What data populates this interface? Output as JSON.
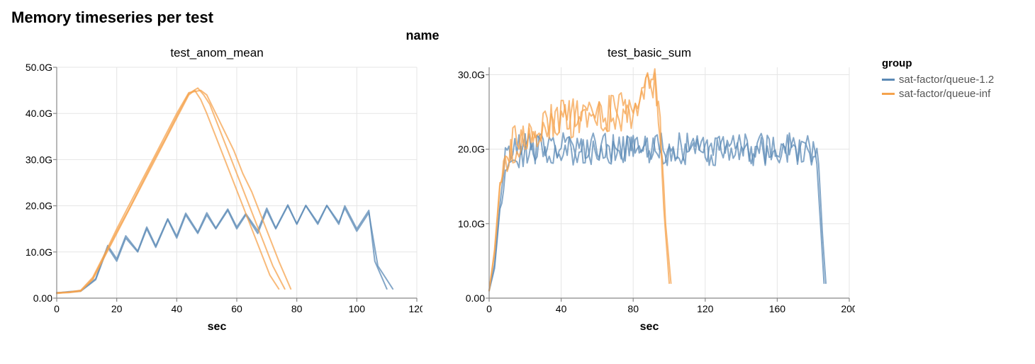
{
  "title": "Memory timeseries per test",
  "facet_label": "name",
  "xlabel": "sec",
  "legend": {
    "title": "group",
    "entries": [
      {
        "name": "sat-factor/queue-1.2",
        "color": "#5b89b5"
      },
      {
        "name": "sat-factor/queue-inf",
        "color": "#f5a34d"
      }
    ]
  },
  "chart_data": [
    {
      "panel_title": "test_anom_mean",
      "type": "line",
      "xlabel": "sec",
      "ylabel": "",
      "xlim": [
        0,
        120
      ],
      "ylim": [
        0,
        50
      ],
      "xticks": [
        0,
        20,
        40,
        60,
        80,
        100,
        120
      ],
      "yticks": [
        0,
        10,
        20,
        30,
        40,
        50
      ],
      "ytick_labels": [
        "0.00",
        "10.0G",
        "20.0G",
        "30.0G",
        "40.0G",
        "50.0G"
      ],
      "series": [
        {
          "name": "sat-factor/queue-1.2",
          "color": "#5b89b5",
          "runs": [
            [
              [
                0,
                1.2
              ],
              [
                4,
                1.3
              ],
              [
                8,
                1.5
              ],
              [
                13,
                4
              ],
              [
                17,
                11
              ],
              [
                20,
                8
              ],
              [
                23,
                13
              ],
              [
                27,
                10
              ],
              [
                30,
                15
              ],
              [
                33,
                11
              ],
              [
                37,
                17
              ],
              [
                40,
                13
              ],
              [
                43,
                18
              ],
              [
                47,
                14
              ],
              [
                50,
                18
              ],
              [
                53,
                15
              ],
              [
                57,
                19
              ],
              [
                60,
                15
              ],
              [
                63,
                18
              ],
              [
                67,
                14
              ],
              [
                70,
                19
              ],
              [
                73,
                15
              ],
              [
                77,
                20
              ],
              [
                80,
                16
              ],
              [
                83,
                20
              ],
              [
                87,
                16
              ],
              [
                90,
                20
              ],
              [
                94,
                16
              ],
              [
                96,
                20
              ],
              [
                100,
                15
              ],
              [
                104,
                19
              ],
              [
                106,
                8
              ],
              [
                110,
                2
              ]
            ],
            [
              [
                0,
                1.1
              ],
              [
                4,
                1.4
              ],
              [
                8,
                1.6
              ],
              [
                13,
                4.2
              ],
              [
                17,
                11.4
              ],
              [
                20,
                8.5
              ],
              [
                23,
                13.5
              ],
              [
                27,
                10.2
              ],
              [
                30,
                15.4
              ],
              [
                33,
                11.3
              ],
              [
                37,
                17.2
              ],
              [
                40,
                13.4
              ],
              [
                43,
                18.4
              ],
              [
                47,
                14.3
              ],
              [
                50,
                18.5
              ],
              [
                53,
                15.2
              ],
              [
                57,
                19.3
              ],
              [
                60,
                15.4
              ],
              [
                63,
                18.3
              ],
              [
                67,
                14.6
              ],
              [
                70,
                19.5
              ],
              [
                73,
                15.2
              ],
              [
                77,
                20.2
              ],
              [
                80,
                16.1
              ],
              [
                83,
                20.1
              ],
              [
                87,
                16.3
              ],
              [
                90,
                20.1
              ],
              [
                94,
                16.4
              ],
              [
                96,
                19.5
              ],
              [
                100,
                14.5
              ],
              [
                104,
                18.5
              ],
              [
                107,
                7
              ],
              [
                112,
                2
              ]
            ]
          ]
        },
        {
          "name": "sat-factor/queue-inf",
          "color": "#f5a34d",
          "runs": [
            [
              [
                0,
                1.2
              ],
              [
                4,
                1.3
              ],
              [
                8,
                1.6
              ],
              [
                12,
                4
              ],
              [
                16,
                9
              ],
              [
                20,
                14
              ],
              [
                24,
                19
              ],
              [
                28,
                24
              ],
              [
                32,
                29
              ],
              [
                36,
                34
              ],
              [
                40,
                39
              ],
              [
                44,
                44
              ],
              [
                46,
                45
              ],
              [
                48,
                43
              ],
              [
                50,
                40
              ],
              [
                53,
                35
              ],
              [
                56,
                30
              ],
              [
                59,
                25
              ],
              [
                62,
                20
              ],
              [
                65,
                15
              ],
              [
                68,
                10
              ],
              [
                71,
                5
              ],
              [
                74,
                2
              ]
            ],
            [
              [
                0,
                1.1
              ],
              [
                4,
                1.2
              ],
              [
                8,
                1.5
              ],
              [
                12,
                4.2
              ],
              [
                16,
                9.3
              ],
              [
                20,
                14.4
              ],
              [
                24,
                19.2
              ],
              [
                28,
                24.3
              ],
              [
                32,
                29.5
              ],
              [
                36,
                34.3
              ],
              [
                40,
                39.4
              ],
              [
                44,
                44.3
              ],
              [
                47,
                45.5
              ],
              [
                49,
                44
              ],
              [
                51,
                42
              ],
              [
                54,
                37
              ],
              [
                57,
                32
              ],
              [
                60,
                27
              ],
              [
                63,
                22
              ],
              [
                66,
                17
              ],
              [
                69,
                12
              ],
              [
                72,
                7
              ],
              [
                76,
                2
              ]
            ],
            [
              [
                0,
                1.0
              ],
              [
                4,
                1.3
              ],
              [
                8,
                1.7
              ],
              [
                12,
                4.5
              ],
              [
                16,
                9.6
              ],
              [
                20,
                15
              ],
              [
                24,
                20
              ],
              [
                28,
                25
              ],
              [
                32,
                30
              ],
              [
                36,
                35
              ],
              [
                40,
                40
              ],
              [
                44,
                44.5
              ],
              [
                48,
                45
              ],
              [
                50,
                44
              ],
              [
                53,
                40
              ],
              [
                56,
                36
              ],
              [
                59,
                32
              ],
              [
                62,
                27
              ],
              [
                65,
                23
              ],
              [
                68,
                18
              ],
              [
                71,
                13
              ],
              [
                74,
                8
              ],
              [
                78,
                2
              ]
            ]
          ]
        }
      ]
    },
    {
      "panel_title": "test_basic_sum",
      "type": "line",
      "xlabel": "sec",
      "ylabel": "",
      "xlim": [
        0,
        200
      ],
      "ylim": [
        0,
        31
      ],
      "xticks": [
        0,
        40,
        80,
        120,
        160,
        200
      ],
      "yticks": [
        0,
        10,
        20,
        30
      ],
      "ytick_labels": [
        "0.00",
        "10.0G",
        "20.0G",
        "30.0G"
      ],
      "series": [
        {
          "name": "sat-factor/queue-1.2",
          "color": "#5b89b5",
          "noise_amp": 2.2,
          "runs": [
            [
              [
                0,
                1
              ],
              [
                3,
                4
              ],
              [
                6,
                12
              ],
              [
                9,
                18
              ],
              [
                12,
                19
              ],
              [
                20,
                20
              ],
              [
                40,
                20
              ],
              [
                60,
                20
              ],
              [
                80,
                20
              ],
              [
                100,
                20
              ],
              [
                120,
                20
              ],
              [
                140,
                20
              ],
              [
                160,
                20
              ],
              [
                178,
                20
              ],
              [
                182,
                18
              ],
              [
                184,
                10
              ],
              [
                186,
                2
              ]
            ],
            [
              [
                0,
                1
              ],
              [
                3,
                4.5
              ],
              [
                6,
                12.5
              ],
              [
                9,
                18.5
              ],
              [
                12,
                19.5
              ],
              [
                20,
                20
              ],
              [
                40,
                20
              ],
              [
                60,
                20
              ],
              [
                80,
                20
              ],
              [
                100,
                20
              ],
              [
                120,
                20
              ],
              [
                140,
                20
              ],
              [
                160,
                20
              ],
              [
                178,
                20
              ],
              [
                183,
                18
              ],
              [
                185,
                9
              ],
              [
                187,
                2
              ]
            ]
          ]
        },
        {
          "name": "sat-factor/queue-inf",
          "color": "#f5a34d",
          "noise_amp": 2.6,
          "runs": [
            [
              [
                0,
                1
              ],
              [
                3,
                6
              ],
              [
                6,
                15
              ],
              [
                9,
                19
              ],
              [
                12,
                20
              ],
              [
                20,
                22
              ],
              [
                30,
                23
              ],
              [
                40,
                24
              ],
              [
                50,
                24
              ],
              [
                60,
                24
              ],
              [
                70,
                25
              ],
              [
                80,
                25
              ],
              [
                86,
                26
              ],
              [
                90,
                30
              ],
              [
                93,
                27
              ],
              [
                95,
                22
              ],
              [
                97,
                12
              ],
              [
                100,
                2
              ]
            ],
            [
              [
                0,
                1
              ],
              [
                3,
                6.5
              ],
              [
                6,
                15.5
              ],
              [
                9,
                19.5
              ],
              [
                12,
                20.5
              ],
              [
                20,
                22.4
              ],
              [
                30,
                23.2
              ],
              [
                40,
                24.2
              ],
              [
                50,
                24.3
              ],
              [
                60,
                24.2
              ],
              [
                70,
                24.8
              ],
              [
                80,
                25.2
              ],
              [
                86,
                26.5
              ],
              [
                90,
                30.5
              ],
              [
                94,
                26
              ],
              [
                96,
                20
              ],
              [
                98,
                10
              ],
              [
                101,
                2
              ]
            ]
          ]
        }
      ]
    }
  ]
}
